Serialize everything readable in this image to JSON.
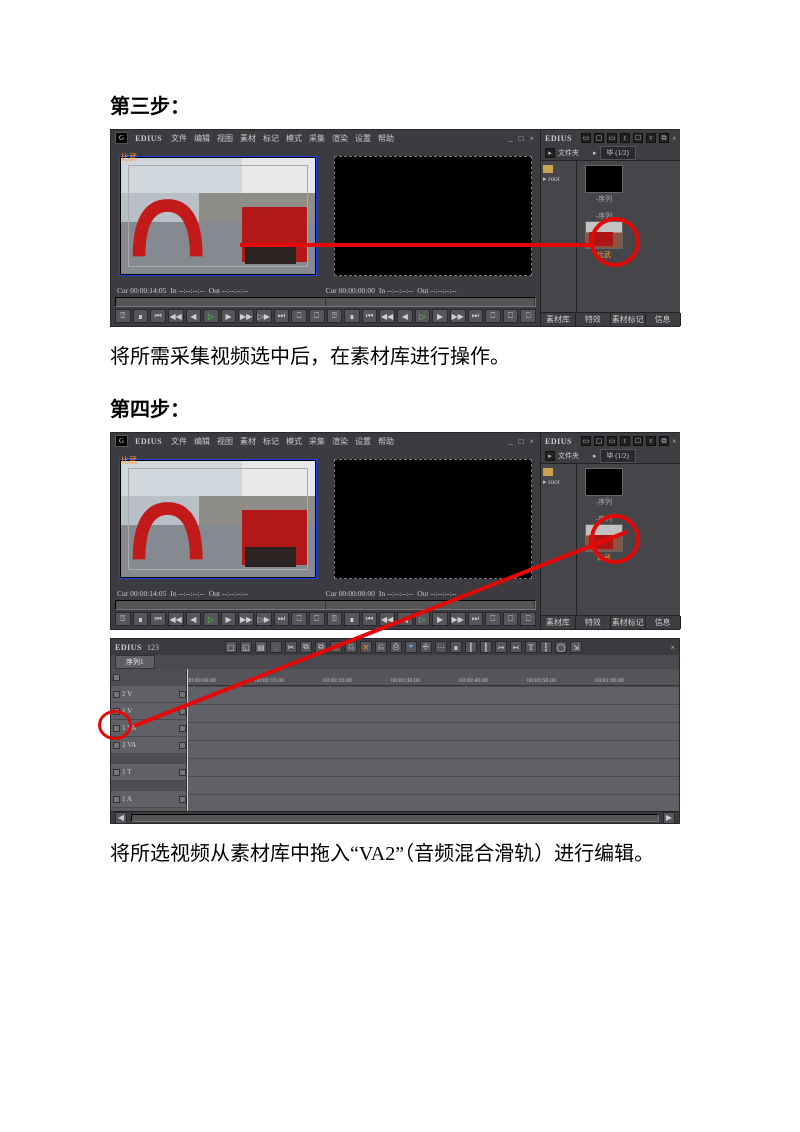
{
  "step3": {
    "heading": "第三步：",
    "caption": "将所需采集视频选中后，在素材库进行操作。"
  },
  "step4": {
    "heading": "第四步：",
    "caption_pre": "将所选视频从素材库中拖入“",
    "caption_code": "VA2",
    "caption_post": "”（音频混合滑轨）进行编辑。"
  },
  "edius": {
    "logo": "G",
    "app_name": "EDIUS",
    "menu": [
      "文件",
      "编辑",
      "视图",
      "素材",
      "标记",
      "模式",
      "采集",
      "渲染",
      "设置",
      "帮助"
    ],
    "win_ctrl": "_ □ ×",
    "clip_title": "比武",
    "tc": {
      "left_cur": "Cur 00:00:14:05",
      "in": "In --:--:--:--",
      "out": "Out --:--:--:--",
      "right_cur": "Cur 00:00:00:00"
    },
    "play_icons_left": [
      "⍰",
      "∎",
      "⏮",
      "◀◀",
      "◀",
      "▷",
      "▶",
      "▶▶",
      "▷▶",
      "⏭",
      "⎕",
      "⎕"
    ],
    "play_icons_right": [
      "⍰",
      "∎",
      "⏮",
      "◀◀",
      "◀",
      "▷",
      "▶",
      "▶▶",
      "⏭",
      "⎕",
      "⎕",
      "⎕"
    ]
  },
  "bin": {
    "toolbar_icons": [
      "▭",
      "▢",
      "▭",
      "t",
      "☐",
      "ᴛ",
      "⧉"
    ],
    "close": "×",
    "folder_label": "文件夹",
    "tree_root": "▸ root",
    "path": "毕 (1/2)",
    "path_icon": "▸",
    "thumb1_label": "-序列",
    "thumb2_label": "比武",
    "tabs": [
      "素材库",
      "特效",
      "素材标记",
      "信息"
    ]
  },
  "timeline": {
    "title": "EDIUS",
    "seq_no": "123",
    "seq_tab": "序列1",
    "tool_icons": [
      "▢",
      "◱",
      "▤",
      ".",
      "✂",
      "⧉",
      "⧉",
      "⌂",
      "⎌",
      "✕",
      "⎌",
      "⎙",
      "⏷",
      "⎆",
      "⋯",
      "∎",
      "┃",
      "┃",
      "↣",
      "↢",
      "T",
      "┇",
      "◯",
      "⇲"
    ],
    "tracks": [
      "2 V",
      "1 V",
      "1 VA",
      "2 VA",
      "1 T",
      "1 A"
    ],
    "ruler": [
      "00:00:00.00",
      "00:00:10.00",
      "00:00:20.00",
      "00:00:30.00",
      "00:00:40.00",
      "00:00:50.00",
      "00:01:00.00"
    ],
    "scroll_icons": [
      "◀",
      "",
      "▶"
    ]
  }
}
